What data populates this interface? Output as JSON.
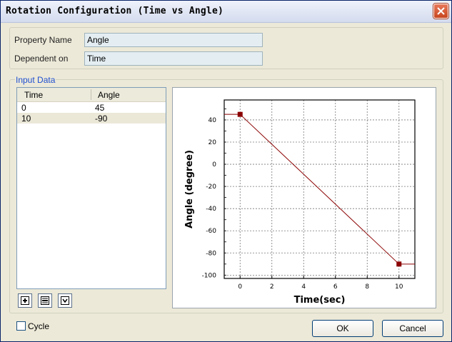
{
  "window": {
    "title": "Rotation Configuration (Time vs Angle)"
  },
  "properties": {
    "property_name_label": "Property Name",
    "property_name_value": "Angle",
    "dependent_on_label": "Dependent on",
    "dependent_on_value": "Time"
  },
  "input_data": {
    "group_label": "Input Data",
    "columns": [
      "Time",
      "Angle"
    ],
    "rows": [
      {
        "time": "0",
        "angle": "45"
      },
      {
        "time": "10",
        "angle": "-90"
      }
    ]
  },
  "toolbar": {
    "icons": [
      "add-row-icon",
      "remove-row-icon",
      "dropdown-icon"
    ]
  },
  "chart_data": {
    "type": "line",
    "xlabel": "Time(sec)",
    "ylabel": "Angle (degree)",
    "x_ticks": [
      "0",
      "2",
      "4",
      "6",
      "8",
      "10"
    ],
    "y_ticks": [
      "40",
      "20",
      "0",
      "-20",
      "-40",
      "-60",
      "-80",
      "-100"
    ],
    "xlim": [
      -1,
      11
    ],
    "ylim": [
      -103,
      58
    ],
    "grid": true,
    "series": [
      {
        "x": [
          0,
          10
        ],
        "y": [
          45,
          -90
        ]
      }
    ],
    "extend_before": 45,
    "extend_after": -90,
    "line_color": "#8b0000",
    "marker_color": "#8b0000"
  },
  "cycle": {
    "label": "Cycle",
    "checked": false
  },
  "buttons": {
    "ok": "OK",
    "cancel": "Cancel"
  }
}
